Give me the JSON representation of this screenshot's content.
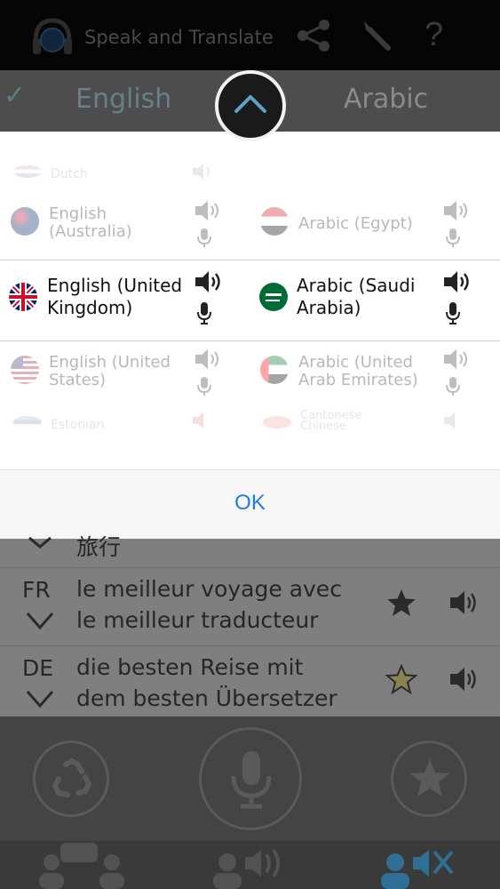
{
  "header": {
    "title": "Speak and Translate",
    "icons": [
      "headphones-globe-icon",
      "share-icon",
      "wrench-icon",
      "help-icon"
    ]
  },
  "language_bar": {
    "source_language": "English",
    "target_language": "Arabic",
    "check_mark": "✓"
  },
  "picker": {
    "rows": [
      {
        "left": "Dutch",
        "right": ""
      },
      {
        "left": "English (Australia)",
        "right": "Arabic (Egypt)"
      },
      {
        "left": "English (United Kingdom)",
        "right": "Arabic (Saudi Arabia)"
      },
      {
        "left": "English (United States)",
        "right": "Arabic (United Arab Emirates)"
      },
      {
        "left": "Estonian",
        "right": "Cantonese Chinese"
      }
    ],
    "ok_label": "OK"
  },
  "translations": [
    {
      "code": "",
      "text_line1": "旅行",
      "text_line2": "",
      "starred": false
    },
    {
      "code": "FR",
      "text_line1": "le meilleur voyage avec",
      "text_line2": "le meilleur traducteur",
      "starred": true
    },
    {
      "code": "DE",
      "text_line1": "die besten Reise mit",
      "text_line2": "dem besten Übersetzer",
      "starred": false
    }
  ],
  "colors": {
    "accent": "#1a7ee8",
    "header_bg": "#050505",
    "overlay_bg": "#7f7f7f"
  }
}
